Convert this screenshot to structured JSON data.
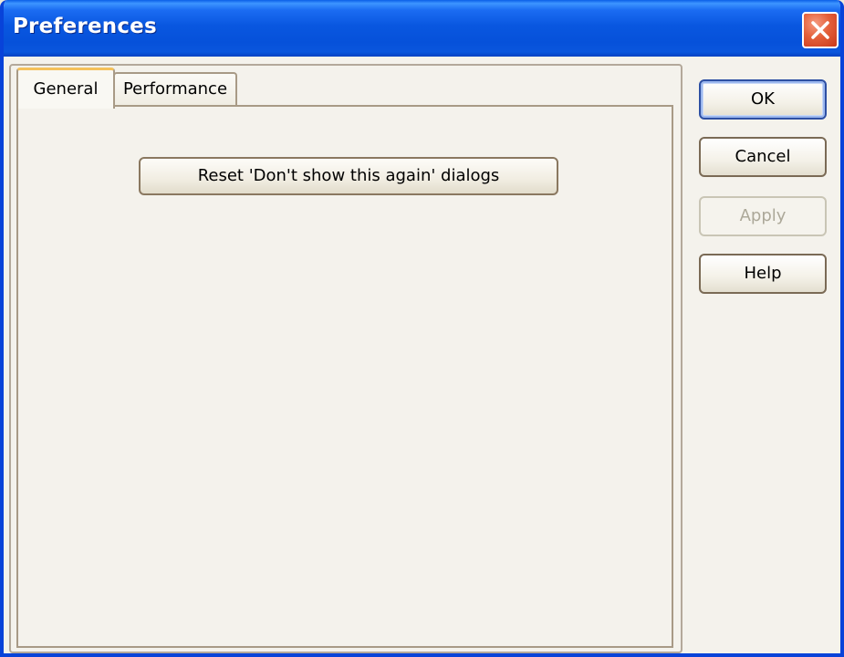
{
  "window": {
    "title": "Preferences"
  },
  "tabs": [
    {
      "label": "General",
      "selected": true
    },
    {
      "label": "Performance",
      "selected": false
    }
  ],
  "general_tab": {
    "reset_button_label": "Reset 'Don't show this again' dialogs"
  },
  "buttons": {
    "ok": "OK",
    "cancel": "Cancel",
    "apply": "Apply",
    "apply_enabled": false,
    "help": "Help"
  },
  "icons": {
    "close": "close-icon"
  },
  "colors": {
    "titlebar": "#0843d9",
    "close_button": "#e4603a",
    "selected_tab_highlight": "#f5c15a",
    "dialog_background": "#f4f2ec"
  }
}
